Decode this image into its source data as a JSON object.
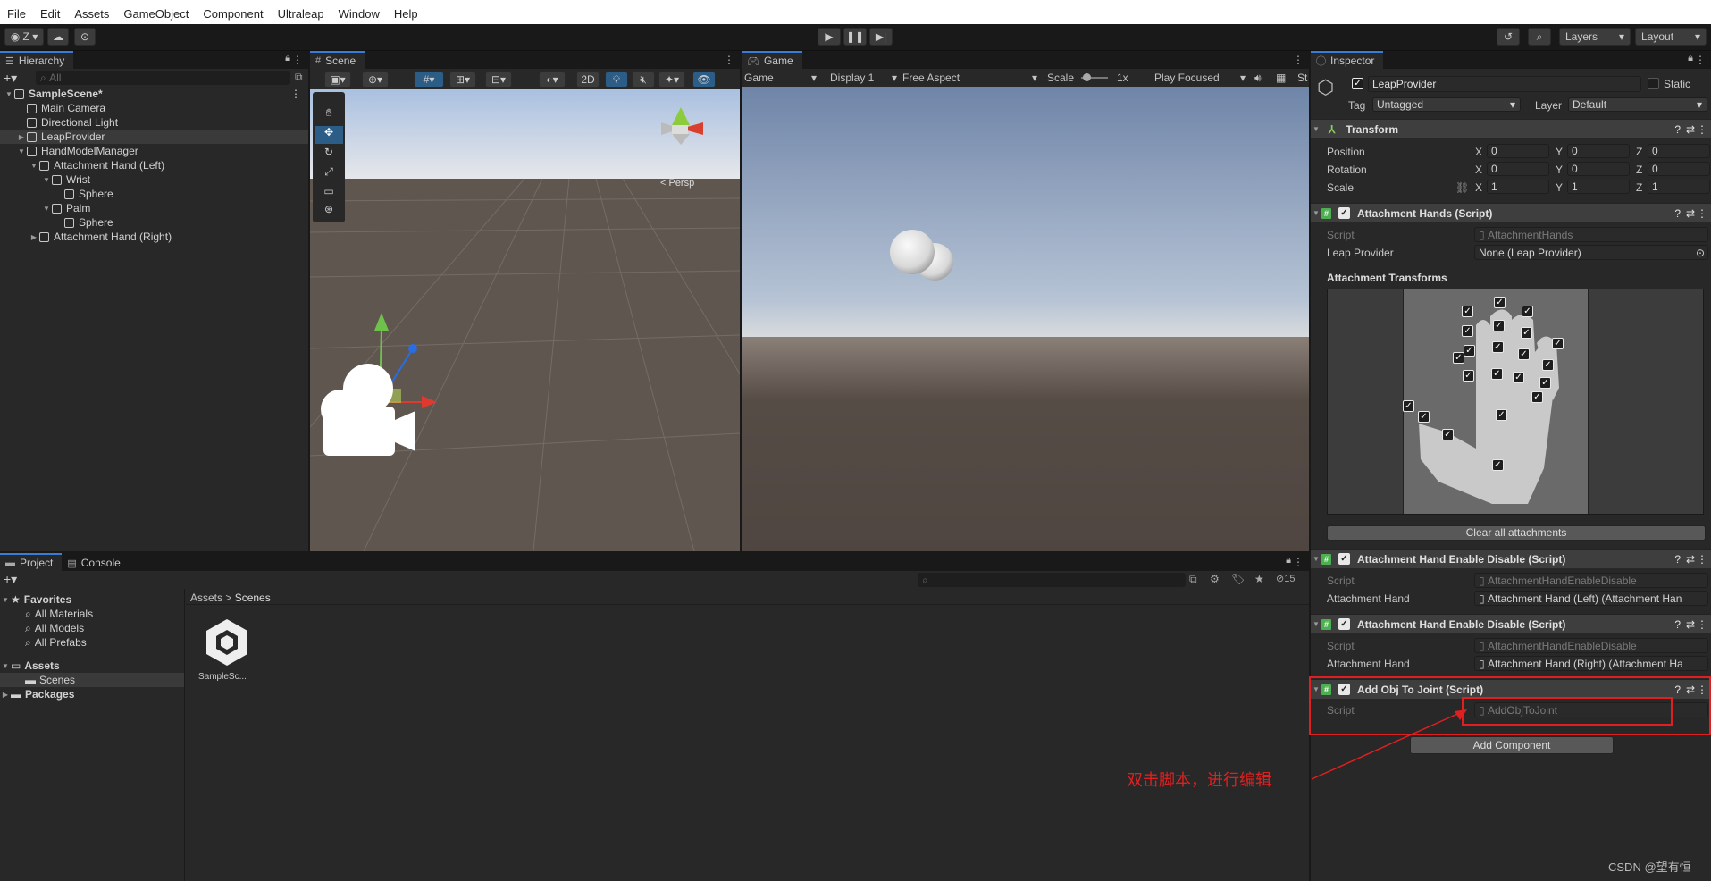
{
  "menu": [
    "File",
    "Edit",
    "Assets",
    "GameObject",
    "Component",
    "Ultraleap",
    "Window",
    "Help"
  ],
  "toolbar": {
    "account": "Z",
    "layers": "Layers",
    "layout": "Layout"
  },
  "hierarchy": {
    "tab": "Hierarchy",
    "search_placeholder": "All",
    "items": [
      {
        "label": "SampleScene*",
        "depth": 0,
        "bold": true
      },
      {
        "label": "Main Camera",
        "depth": 1
      },
      {
        "label": "Directional Light",
        "depth": 1
      },
      {
        "label": "LeapProvider",
        "depth": 1,
        "selected": true
      },
      {
        "label": "HandModelManager",
        "depth": 1
      },
      {
        "label": "Attachment Hand (Left)",
        "depth": 2
      },
      {
        "label": "Wrist",
        "depth": 3
      },
      {
        "label": "Sphere",
        "depth": 4
      },
      {
        "label": "Palm",
        "depth": 3
      },
      {
        "label": "Sphere",
        "depth": 4
      },
      {
        "label": "Attachment Hand (Right)",
        "depth": 2
      }
    ]
  },
  "scene": {
    "tab": "Scene",
    "mode2d": "2D",
    "persp": "< Persp"
  },
  "game": {
    "tab": "Game",
    "view": "Game",
    "display": "Display 1",
    "aspect": "Free Aspect",
    "scale_label": "Scale",
    "scale_value": "1x",
    "play_mode": "Play Focused",
    "stats": "St"
  },
  "project": {
    "tabs": [
      "Project",
      "Console"
    ],
    "favorites_label": "Favorites",
    "favorites": [
      "All Materials",
      "All Models",
      "All Prefabs"
    ],
    "assets_label": "Assets",
    "scenes_label": "Scenes",
    "packages_label": "Packages",
    "breadcrumb": [
      "Assets",
      "Scenes"
    ],
    "asset_name": "SampleSc...",
    "hidden_count": "15"
  },
  "inspector": {
    "tab": "Inspector",
    "object_name": "LeapProvider",
    "static_label": "Static",
    "tag_label": "Tag",
    "tag_value": "Untagged",
    "layer_label": "Layer",
    "layer_value": "Default",
    "transform": {
      "title": "Transform",
      "rows": [
        {
          "label": "Position",
          "x": "0",
          "y": "0",
          "z": "0"
        },
        {
          "label": "Rotation",
          "x": "0",
          "y": "0",
          "z": "0"
        },
        {
          "label": "Scale",
          "x": "1",
          "y": "1",
          "z": "1"
        }
      ]
    },
    "attachment_hands": {
      "title": "Attachment Hands (Script)",
      "script_label": "Script",
      "script_value": "AttachmentHands",
      "provider_label": "Leap Provider",
      "provider_value": "None (Leap Provider)",
      "transforms_label": "Attachment Transforms",
      "clear_button": "Clear all attachments"
    },
    "enable_disable_1": {
      "title": "Attachment Hand Enable Disable (Script)",
      "script_label": "Script",
      "script_value": "AttachmentHandEnableDisable",
      "hand_label": "Attachment Hand",
      "hand_value": "Attachment Hand (Left) (Attachment Han"
    },
    "enable_disable_2": {
      "title": "Attachment Hand Enable Disable (Script)",
      "script_label": "Script",
      "script_value": "AttachmentHandEnableDisable",
      "hand_label": "Attachment Hand",
      "hand_value": "Attachment Hand (Right) (Attachment Ha"
    },
    "add_obj": {
      "title": "Add Obj To Joint (Script)",
      "script_label": "Script",
      "script_value": "AddObjToJoint"
    },
    "add_component": "Add Component"
  },
  "annotation": {
    "text": "双击脚本，进行编辑",
    "color": "#e02020"
  },
  "watermark": "CSDN @望有恒",
  "colors": {
    "accent": "#3a7bd5",
    "selection": "#2c5d87",
    "annotation": "#e02020"
  }
}
